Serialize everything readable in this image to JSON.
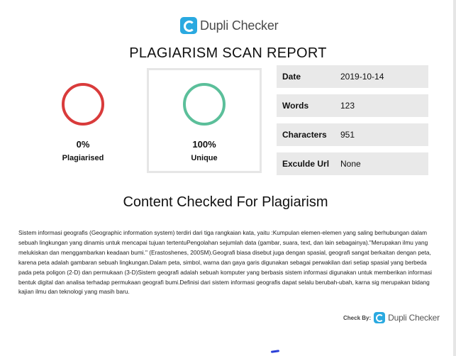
{
  "brand": {
    "name": "Dupli Checker",
    "color": "#2aa9e0"
  },
  "report": {
    "title": "PLAGIARISM SCAN REPORT"
  },
  "metrics": {
    "plagiarised": {
      "value": "0%",
      "label": "Plagiarised",
      "color": "#d93b3b"
    },
    "unique": {
      "value": "100%",
      "label": "Unique",
      "color": "#5bbf9a"
    }
  },
  "info": [
    {
      "key": "Date",
      "value": "2019-10-14"
    },
    {
      "key": "Words",
      "value": "123"
    },
    {
      "key": "Characters",
      "value": "951"
    },
    {
      "key": "Exculde Url",
      "value": "None"
    }
  ],
  "content": {
    "title": "Content Checked For Plagiarism",
    "text": "Sistem informasi geografis (Geographic information system) terdiri dari tiga rangkaian kata, yaitu :Kumpulan elemen-elemen yang saling berhubungan dalam sebuah lingkungan yang dinamis untuk mencapai tujuan tertentuPengolahan sejumlah data (gambar, suara, text, dan lain sebagainya).\"Merupakan ilmu yang melukiskan dan menggambarkan keadaan bumi.\" (Erastoshenes, 200SM).Geografi biasa disebut juga dengan spasial, geografi sangat berkaitan dengan peta, karena peta adalah gambaran sebuah lingkungan.Dalam peta, simbol, warna dan gaya garis digunakan sebagai perwakilan dari setiap spasial yang berbeda pada peta poligon (2-D) dan permukaan (3-D)Sistem geografi adalah sebuah komputer yang berbasis sistem informasi digunakan untuk memberikan informasi bentuk digital dan analisa terhadap permukaan geografi bumi.Definisi dari sistem informasi geografis dapat selalu berubah-ubah, karna sig merupakan bidang kajian ilmu dan teknologi yang masih baru."
  },
  "footer": {
    "check_by_label": "Check By:",
    "brand": "Dupli Checker"
  }
}
